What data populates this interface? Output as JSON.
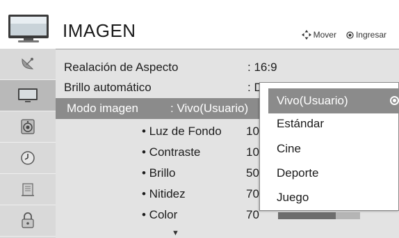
{
  "header": {
    "title": "IMAGEN",
    "hint_move": "Mover",
    "hint_enter": "Ingresar"
  },
  "sidebar": {
    "items": [
      {
        "icon": "satellite-dish-icon",
        "active": false
      },
      {
        "icon": "tv-monitor-icon",
        "active": true
      },
      {
        "icon": "speaker-icon",
        "active": false
      },
      {
        "icon": "clock-icon",
        "active": false
      },
      {
        "icon": "building-icon",
        "active": false
      },
      {
        "icon": "lock-icon",
        "active": false
      }
    ]
  },
  "settings": {
    "aspect_ratio": {
      "label": "Realación de Aspecto",
      "value": ": 16:9"
    },
    "auto_brightness": {
      "label": "Brillo automático",
      "value": ": D"
    },
    "picture_mode": {
      "label": "Modo imagen",
      "value": ": Vivo(Usuario)"
    },
    "backlight": {
      "label": "• Luz de Fondo",
      "value": "10"
    },
    "contrast": {
      "label": "• Contraste",
      "value": "10"
    },
    "brightness": {
      "label": "• Brillo",
      "value": "50"
    },
    "sharpness": {
      "label": "• Nitidez",
      "value": "70"
    },
    "color": {
      "label": "• Color",
      "value": "70",
      "level": 0.7
    }
  },
  "scroll_indicator": "▼",
  "popup": {
    "selected": "Vivo(Usuario)",
    "options": [
      "Estándar",
      "Cine",
      "Deporte",
      "Juego"
    ]
  }
}
